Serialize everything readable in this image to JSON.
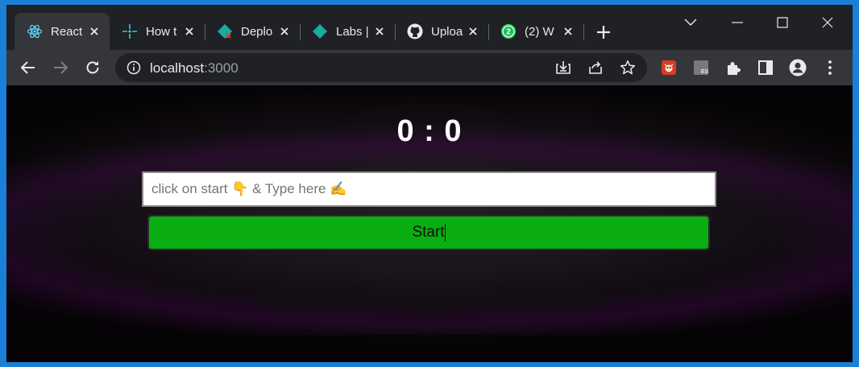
{
  "browser": {
    "tabs": [
      {
        "title": "React",
        "icon": "react-icon",
        "active": true
      },
      {
        "title": "How t",
        "icon": "cluster-icon"
      },
      {
        "title": "Deplo",
        "icon": "diamond-error-icon"
      },
      {
        "title": "Labs |",
        "icon": "diamond-icon"
      },
      {
        "title": "Uploa",
        "icon": "github-icon"
      },
      {
        "title": "(2) W",
        "icon": "whatsapp-icon",
        "badge": "2"
      }
    ],
    "address": {
      "host": "localhost",
      "port": ":3000"
    },
    "colors": {
      "accent": "#1a7fd6",
      "tab_active": "#35363a",
      "frame": "#202124"
    }
  },
  "game": {
    "score": "0 : 0",
    "input_placeholder": "click on start 👇 & Type here ✍️",
    "start_label": "Start",
    "start_color": "#0aad12"
  }
}
